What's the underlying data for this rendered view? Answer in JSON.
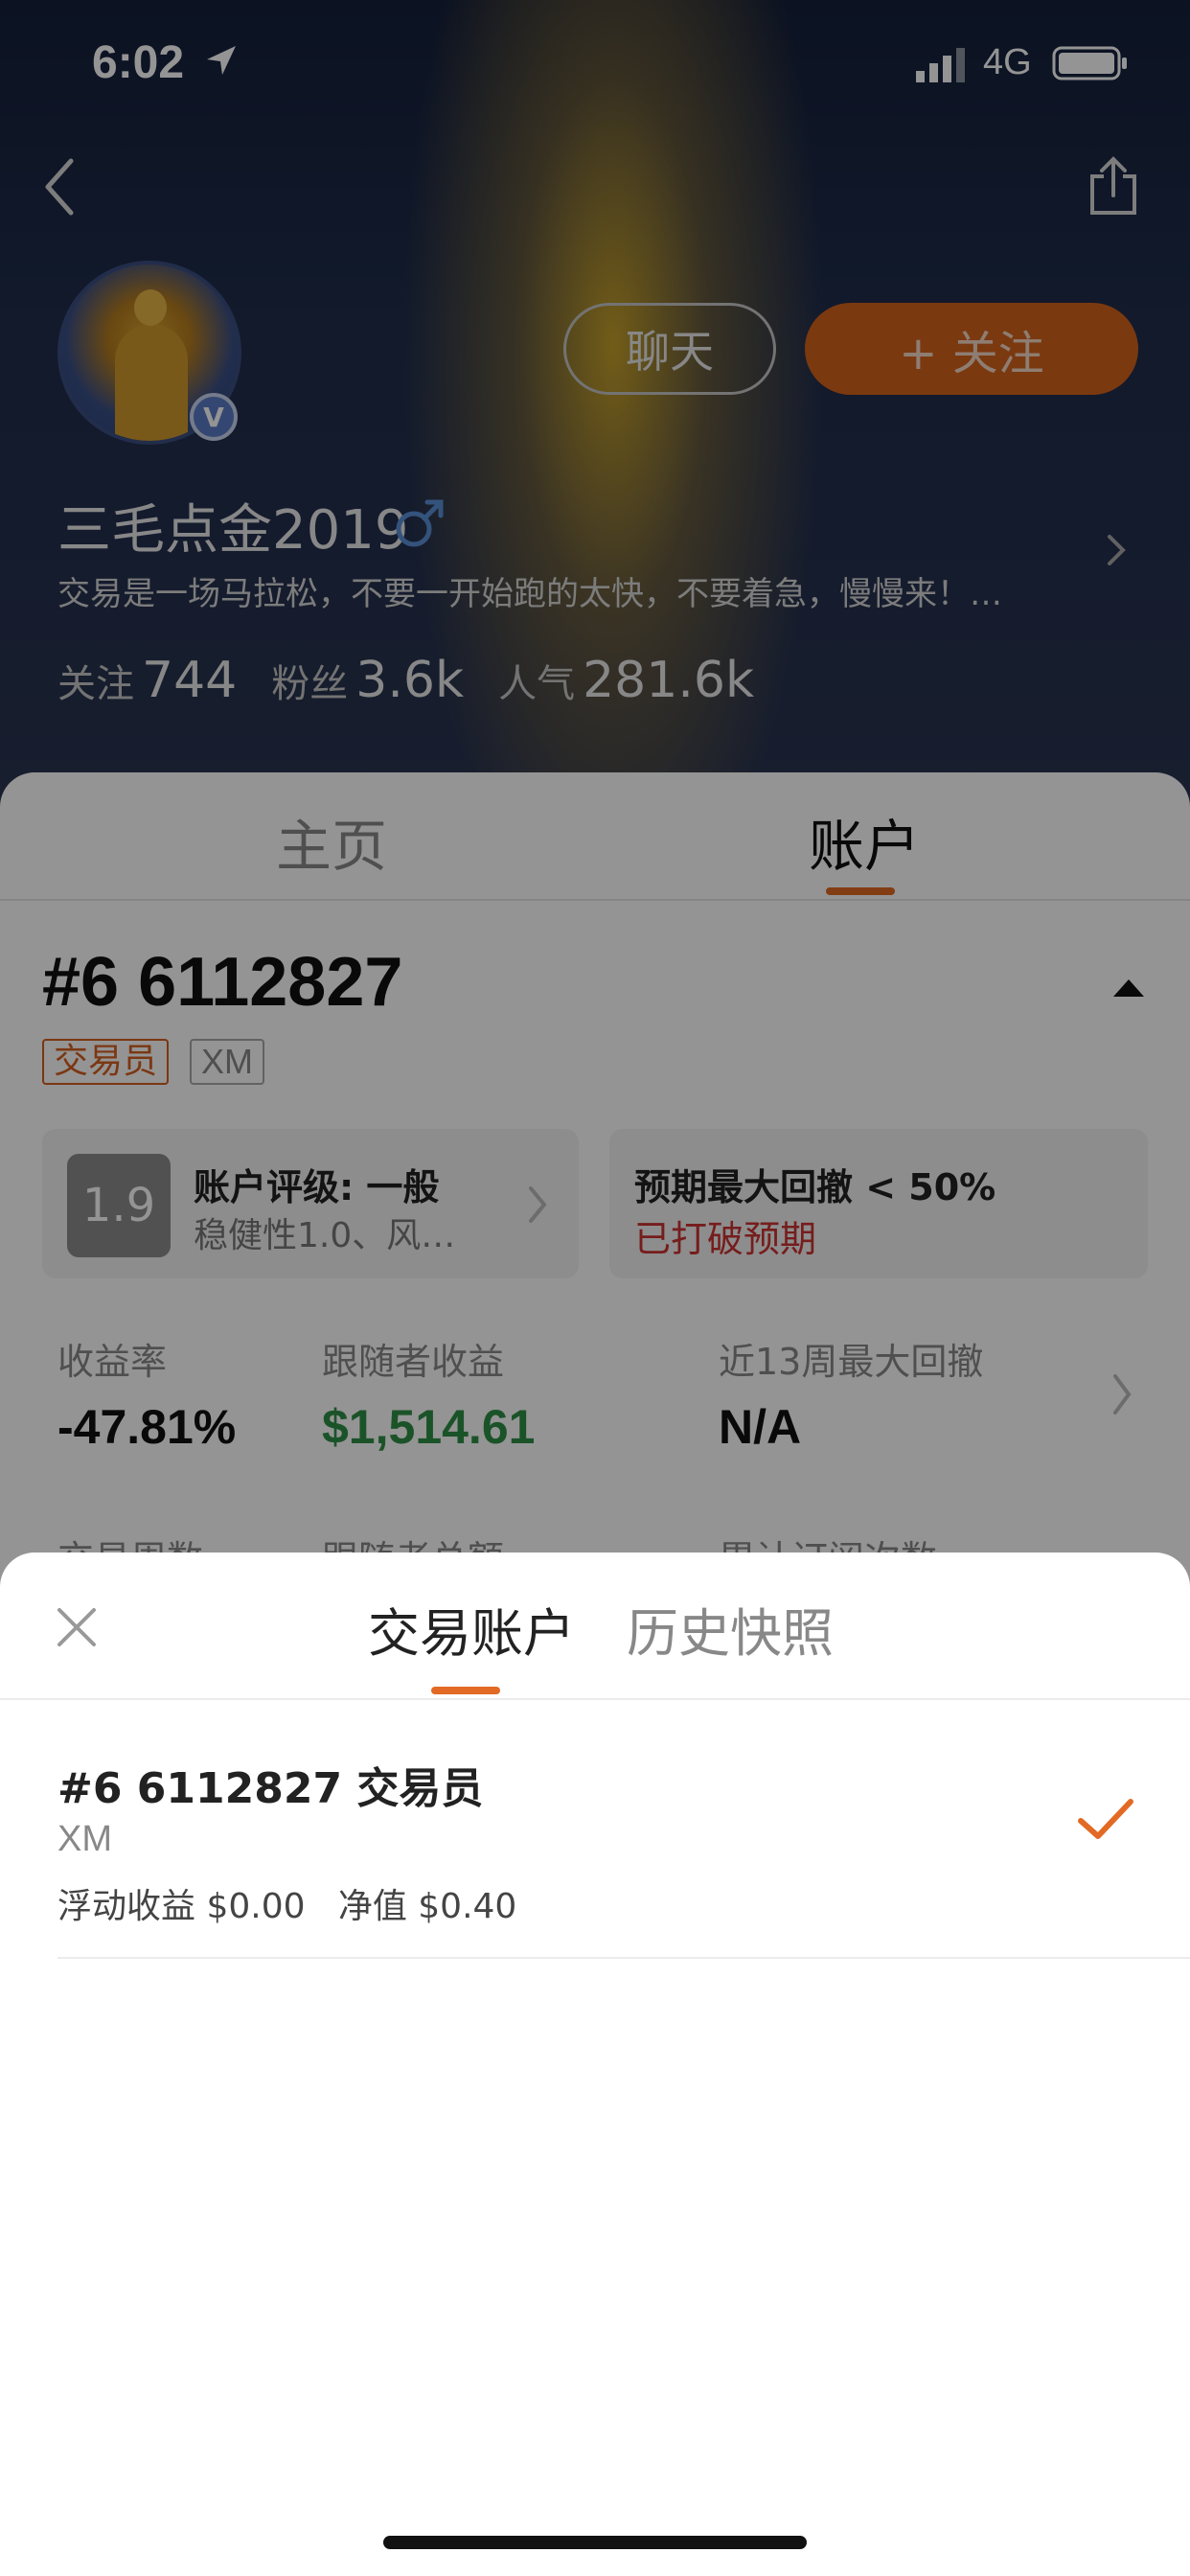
{
  "status_bar": {
    "time": "6:02",
    "network": "4G"
  },
  "profile": {
    "username": "三毛点金2019",
    "bio": "交易是一场马拉松，不要一开始跑的太快，不要着急，慢慢来！…",
    "verified_badge": "V",
    "chat_label": "聊天",
    "follow_label": "+ 关注",
    "stats": [
      {
        "label": "关注",
        "value": "744"
      },
      {
        "label": "粉丝",
        "value": "3.6k"
      },
      {
        "label": "人气",
        "value": "281.6k"
      }
    ]
  },
  "tabs": {
    "home": "主页",
    "account": "账户"
  },
  "account": {
    "title": "#6 6112827",
    "tag_trader": "交易员",
    "tag_broker": "XM",
    "rating": {
      "score": "1.9",
      "title": "账户评级: 一般",
      "subtitle": "稳健性1.0、风…"
    },
    "drawdown": {
      "title": "预期最大回撤 < 50%",
      "status": "已打破预期"
    },
    "metrics": [
      {
        "label": "收益率",
        "value": "-47.81%"
      },
      {
        "label": "跟随者收益",
        "value": "$1,514.61"
      },
      {
        "label": "近13周最大回撤",
        "value": "N/A"
      }
    ],
    "metrics_row2": [
      "交易周数",
      "跟随者总额",
      "累计订阅次数"
    ]
  },
  "sheet": {
    "tab_active": "交易账户",
    "tab_history": "历史快照",
    "items": [
      {
        "title": "#6 6112827 交易员",
        "broker": "XM",
        "stats": "浮动收益 $0.00   净值 $0.40"
      }
    ]
  },
  "colors": {
    "accent": "#e26a24",
    "positive": "#2f8f47",
    "negative_status": "#cc3333"
  }
}
